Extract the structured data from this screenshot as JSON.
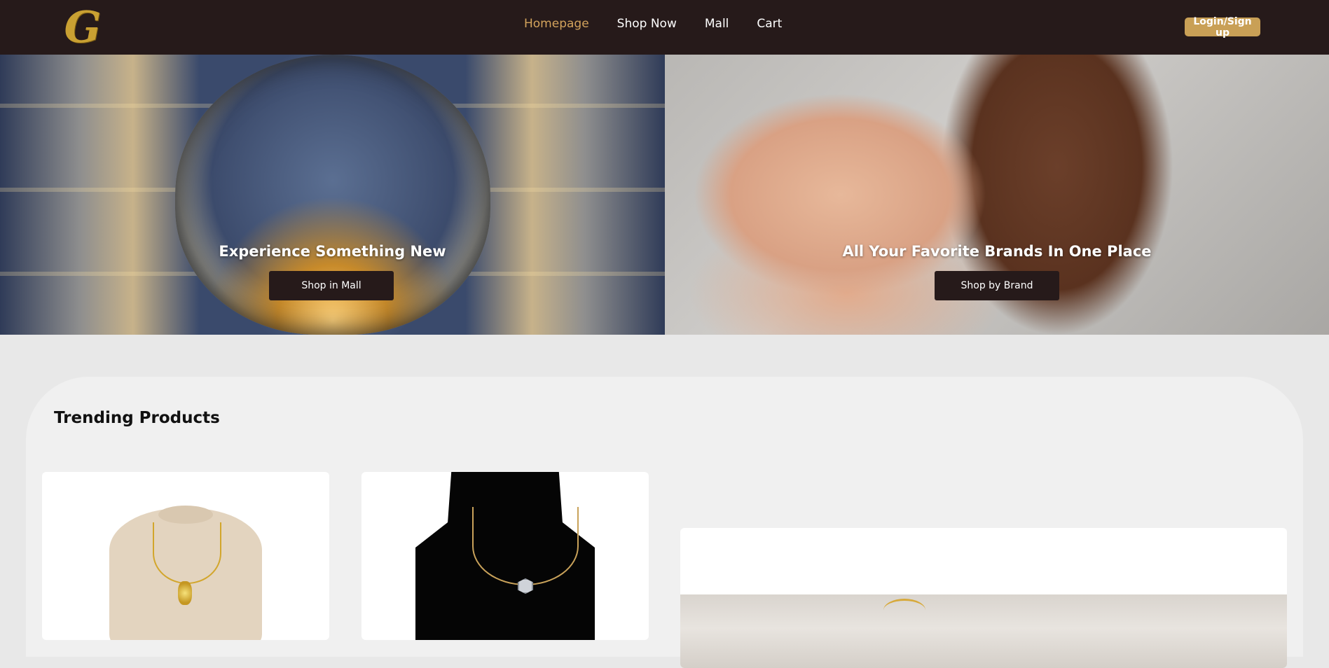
{
  "header": {
    "logo_letter": "G",
    "nav": [
      {
        "label": "Homepage",
        "active": true
      },
      {
        "label": "Shop Now",
        "active": false
      },
      {
        "label": "Mall",
        "active": false
      },
      {
        "label": "Cart",
        "active": false
      }
    ],
    "login_label": "Login/Sign up"
  },
  "hero": {
    "mall": {
      "title": "Experience Something New",
      "button": "Shop in Mall"
    },
    "brands": {
      "title": "All Your Favorite Brands In One Place",
      "button": "Shop by Brand"
    }
  },
  "trending": {
    "title": "Trending Products"
  },
  "colors": {
    "header_bg": "#261a1a",
    "accent_gold": "#c9a056",
    "nav_active": "#d3a35c"
  }
}
